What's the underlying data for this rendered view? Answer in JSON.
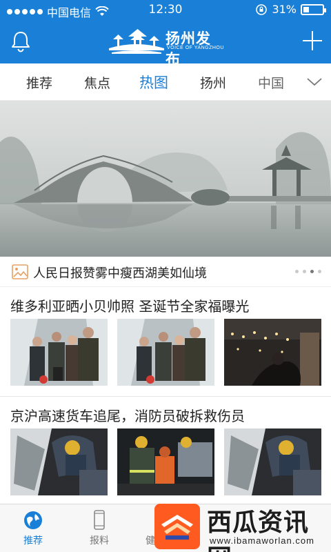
{
  "status_bar": {
    "carrier": "中国电信",
    "time": "12:30",
    "battery": "31%",
    "battery_level": 0.31
  },
  "app": {
    "title": "扬州发布",
    "subtitle": "VOICE OF YANGZHOU",
    "left_icon": "bell-icon",
    "right_icon": "plus-icon"
  },
  "tabs": [
    "推荐",
    "焦点",
    "热图",
    "扬州",
    "中国"
  ],
  "active_tab": "热图",
  "hero": {
    "caption": "人民日报赞雾中瘦西湖美如仙境",
    "pages": 4,
    "current_page": 3
  },
  "news": [
    {
      "headline": "维多利亚晒小贝帅照 圣诞节全家福曝光"
    },
    {
      "headline": "京沪高速货车追尾，消防员破拆救伤员"
    }
  ],
  "tabbar": {
    "items": [
      "推荐",
      "报料",
      "健"
    ],
    "active": "推荐"
  },
  "watermark": {
    "name": "西瓜资讯网",
    "url": "www.ibamaworlan.com"
  },
  "colors": {
    "brand": "#1a7fd6",
    "watermark_orange": "#ff5a1f"
  }
}
